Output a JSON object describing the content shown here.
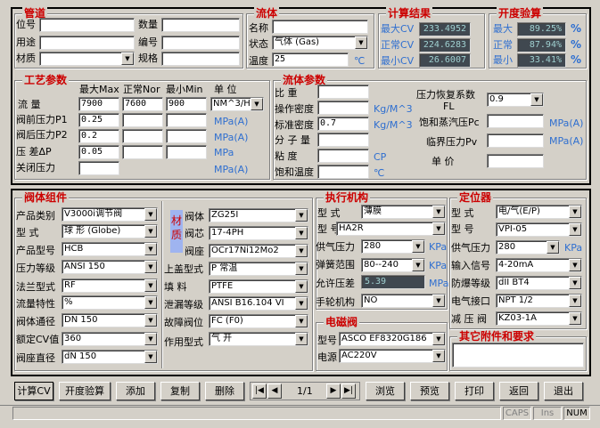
{
  "pipe": {
    "title": "管道",
    "pos": "位号",
    "use": "用途",
    "mat": "材质",
    "qty": "数量",
    "no": "编号",
    "spec": "规格",
    "mat_val": ""
  },
  "fluid": {
    "title": "流体",
    "name": "名称",
    "state": "状态",
    "temp": "温度",
    "state_val": "气体 (Gas)",
    "temp_val": "25",
    "temp_unit": "℃"
  },
  "calc": {
    "title": "计算结果",
    "max": "最大CV",
    "norm": "正常CV",
    "min": "最小CV",
    "max_val": "233.4952",
    "norm_val": "224.6283",
    "min_val": "26.6007"
  },
  "open": {
    "title": "开度验算",
    "max": "最大",
    "norm": "正常",
    "min": "最小",
    "max_val": "89.25%",
    "norm_val": "87.94%",
    "min_val": "33.41%",
    "pct": "%"
  },
  "process": {
    "title": "工艺参数",
    "flow": "流  量",
    "hdr_max": "最大Max",
    "hdr_nor": "正常Nor",
    "hdr_min": "最小Min",
    "hdr_unit": "单 位",
    "flow_max": "7900",
    "flow_nor": "7600",
    "flow_min": "900",
    "flow_unit": "NM^3/H",
    "p1": "阀前压力P1",
    "p1_val": "0.25",
    "p1_unit": "MPa(A)",
    "p2": "阀后压力P2",
    "p2_val": "0.2",
    "p2_unit": "MPa(A)",
    "dp": "压  差ΔP",
    "dp_val": "0.05",
    "dp_unit": "MPa",
    "close": "关闭压力",
    "close_unit": "MPa(A)"
  },
  "fparams": {
    "title": "流体参数",
    "ratio": "比  重",
    "opd": "操作密度",
    "opd_unit": "Kg/M^3",
    "std": "标准密度",
    "std_val": "0.7",
    "std_unit": "Kg/M^3",
    "mw": "分 子 量",
    "visc": "粘  度",
    "visc_unit": "CP",
    "sat": "饱和温度",
    "sat_unit": "℃",
    "fl": "压力恢复系数",
    "fl2": "FL",
    "fl_val": "0.9",
    "pc": "饱和蒸汽压Pc",
    "pc_unit": "MPa(A)",
    "pv": "临界压力Pv",
    "pv_unit": "MPa(A)",
    "price": "单    价"
  },
  "body": {
    "title": "阀体组件",
    "type_l": "产品类别",
    "type_v": "V3000i调节阀",
    "form_l": "型  式",
    "form_v": "球 形 (Globe)",
    "model_l": "产品型号",
    "model_v": "HCB",
    "pclass_l": "压力等级",
    "pclass_v": "ANSI 150",
    "flange_l": "法兰型式",
    "flange_v": "RF",
    "char_l": "流量特性",
    "char_v": "%",
    "dn_l": "阀体通径",
    "dn_v": "DN 150",
    "cv_l": "额定CV值",
    "cv_v": "360",
    "seat_l": "阀座直径",
    "seat_v": "dN 150",
    "mat_l": "材质",
    "mbody_l": "阀体",
    "mbody_v": "ZG25I",
    "mcore_l": "阀芯",
    "mcore_v": "17-4PH",
    "mseat_l": "阀座",
    "mseat_v": "OCr17Ni12Mo2",
    "bonnet_l": "上盖型式",
    "bonnet_v": "P 常温",
    "pack_l": "填  料",
    "pack_v": "PTFE",
    "leak_l": "泄漏等级",
    "leak_v": "ANSI B16.104 VI",
    "fail_l": "故障阀位",
    "fail_v": "FC (F0)",
    "act_l": "作用型式",
    "act_v": "气    开"
  },
  "actuator": {
    "title": "执行机构",
    "type_l": "型  式",
    "type_v": "薄膜",
    "model_l": "型  号",
    "model_v": "HA2R",
    "air_l": "供气压力",
    "air_v": "280",
    "air_u": "KPa",
    "spring_l": "弹簧范围",
    "spring_v": "80--240",
    "spring_u": "KPa",
    "allow_l": "允许压差",
    "allow_v": "5.39",
    "allow_u": "MPa",
    "hand_l": "手轮机构",
    "hand_v": "NO"
  },
  "solenoid": {
    "title": "电磁阀",
    "model_l": "型号",
    "model_v": "ASCO EF8320G186",
    "power_l": "电源",
    "power_v": "AC220V"
  },
  "positioner": {
    "title": "定位器",
    "type_l": "型  式",
    "type_v": "电/气(E/P)",
    "model_l": "型  号",
    "model_v": "VPI-05",
    "air_l": "供气压力",
    "air_v": "280",
    "air_u": "KPa",
    "sig_l": "输入信号",
    "sig_v": "4-20mA",
    "ex_l": "防爆等级",
    "ex_v": "dII BT4",
    "conn_l": "电气接口",
    "conn_v": "NPT 1/2",
    "reg_l": "减 压 阀",
    "reg_v": "KZ03-1A"
  },
  "other": {
    "title": "其它附件和要求"
  },
  "toolbar": {
    "calc": "计算CV",
    "open": "开度验算",
    "add": "添加",
    "copy": "复制",
    "del": "删除",
    "page": "1/1",
    "browse": "浏览",
    "preview": "预览",
    "print": "打印",
    "back": "返回",
    "exit": "退出"
  },
  "status": {
    "caps": "CAPS",
    "ins": "Ins",
    "num": "NUM"
  }
}
